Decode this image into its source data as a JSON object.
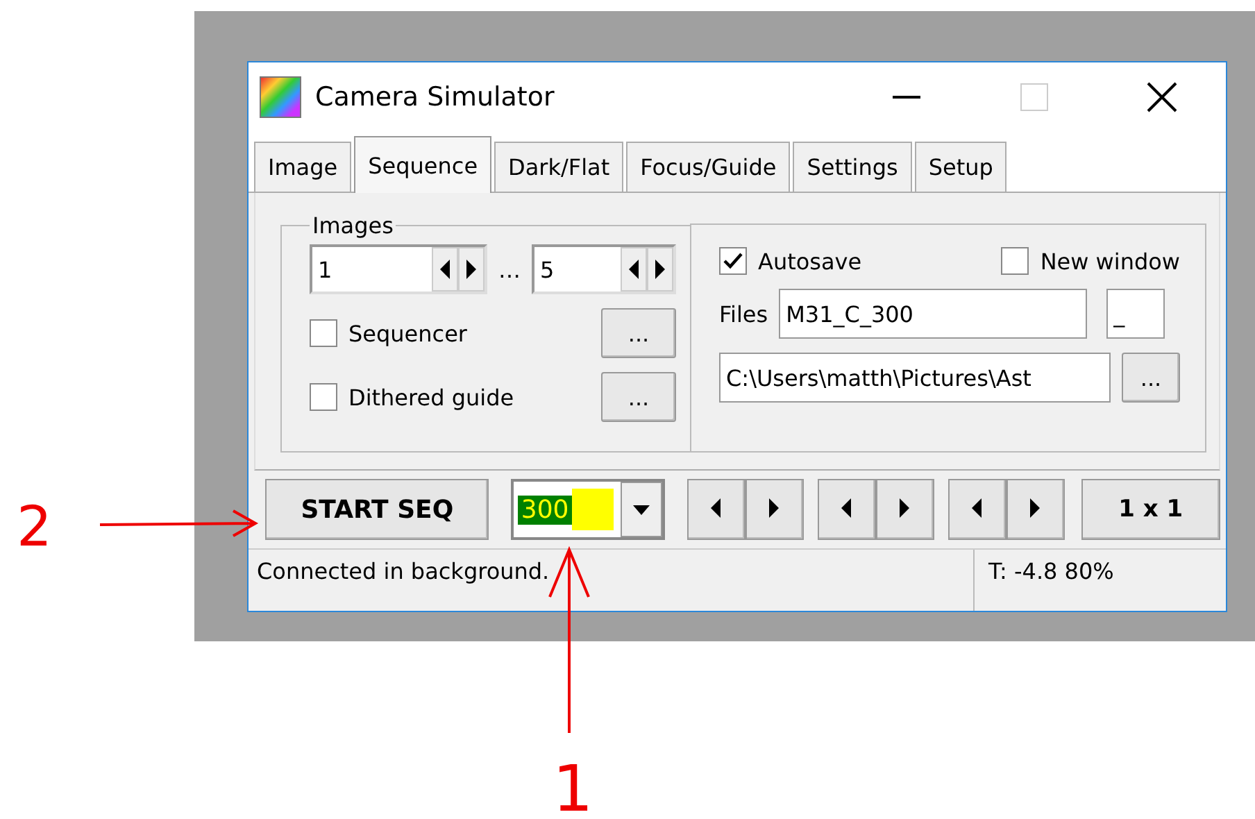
{
  "window": {
    "title": "Camera Simulator"
  },
  "tabs": [
    {
      "label": "Image",
      "selected": false
    },
    {
      "label": "Sequence",
      "selected": true
    },
    {
      "label": "Dark/Flat",
      "selected": false
    },
    {
      "label": "Focus/Guide",
      "selected": false
    },
    {
      "label": "Settings",
      "selected": false
    },
    {
      "label": "Setup",
      "selected": false
    }
  ],
  "images_group": {
    "title": "Images",
    "from": "1",
    "separator": "…",
    "to": "5",
    "options": [
      {
        "label": "Sequencer",
        "checked": false,
        "button": "..."
      },
      {
        "label": "Dithered guide",
        "checked": false,
        "button": "..."
      }
    ]
  },
  "save_group": {
    "autosave": {
      "label": "Autosave",
      "checked": true
    },
    "new_window": {
      "label": "New window",
      "checked": false
    },
    "files_label": "Files",
    "file_name": "M31_C_300",
    "suffix": "_",
    "path": "C:\\Users\\matth\\Pictures\\Ast",
    "browse_button": "..."
  },
  "toolbar": {
    "start_button": "START SEQ",
    "exposure": "300",
    "binning_button": "1 x 1"
  },
  "status_bar": {
    "message": "Connected in background.",
    "temperature": "T: -4.8  80%"
  },
  "annotations": [
    {
      "label": "2"
    },
    {
      "label": "1"
    }
  ]
}
